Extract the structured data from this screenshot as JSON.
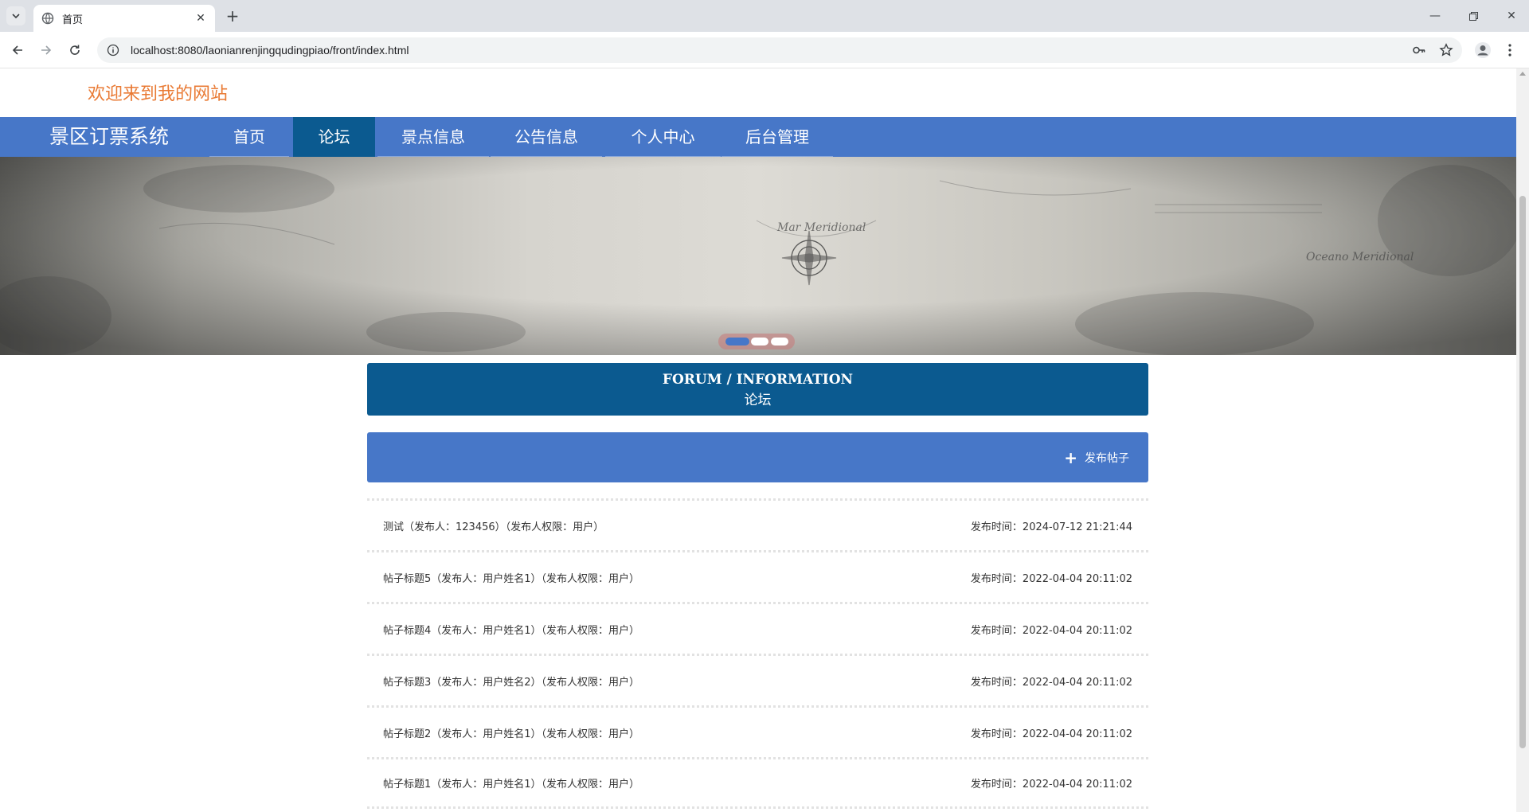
{
  "browser": {
    "tab_title": "首页",
    "url": "localhost:8080/laonianrenjingqudingpiao/front/index.html"
  },
  "site": {
    "welcome": "欢迎来到我的网站",
    "brand": "景区订票系统",
    "nav": [
      {
        "label": "首页",
        "active": false
      },
      {
        "label": "论坛",
        "active": true
      },
      {
        "label": "景点信息",
        "active": false
      },
      {
        "label": "公告信息",
        "active": false
      },
      {
        "label": "个人中心",
        "active": false
      },
      {
        "label": "后台管理",
        "active": false
      }
    ]
  },
  "banner": {
    "slides": 3,
    "active_slide": 1
  },
  "forum": {
    "title_en": "FORUM / INFORMATION",
    "title_cn": "论坛",
    "post_button": "发布帖子",
    "posts": [
      {
        "title": "测试（发布人：123456）（发布人权限：用户）",
        "time": "发布时间：2024-07-12 21:21:44"
      },
      {
        "title": "帖子标题5（发布人：用户姓名1）（发布人权限：用户）",
        "time": "发布时间：2022-04-04 20:11:02"
      },
      {
        "title": "帖子标题4（发布人：用户姓名1）（发布人权限：用户）",
        "time": "发布时间：2022-04-04 20:11:02"
      },
      {
        "title": "帖子标题3（发布人：用户姓名2）（发布人权限：用户）",
        "time": "发布时间：2022-04-04 20:11:02"
      },
      {
        "title": "帖子标题2（发布人：用户姓名1）（发布人权限：用户）",
        "time": "发布时间：2022-04-04 20:11:02"
      },
      {
        "title": "帖子标题1（发布人：用户姓名1）（发布人权限：用户）",
        "time": "发布时间：2022-04-04 20:11:02"
      }
    ]
  },
  "colors": {
    "nav_bg": "#4777c8",
    "nav_active": "#0b5a90",
    "welcome_text": "#e97a34"
  }
}
